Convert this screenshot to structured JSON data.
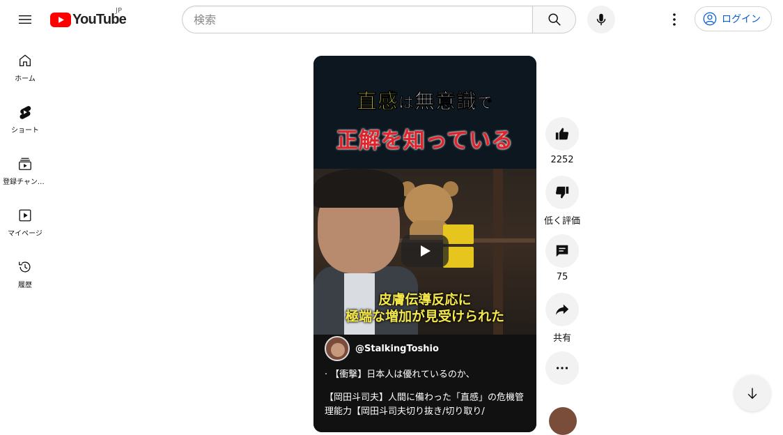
{
  "header": {
    "logo_text": "YouTube",
    "country_code": "JP",
    "search_placeholder": "検索",
    "login_label": "ログイン"
  },
  "sidebar": {
    "items": [
      {
        "label": "ホーム",
        "icon": "home-icon"
      },
      {
        "label": "ショート",
        "icon": "shorts-icon"
      },
      {
        "label": "登録チャンネル",
        "icon": "subscriptions-icon"
      },
      {
        "label": "マイページ",
        "icon": "my-page-icon"
      },
      {
        "label": "履歴",
        "icon": "history-icon"
      }
    ]
  },
  "short": {
    "caption_top_yellow1": "直感",
    "caption_top_white1": "は",
    "caption_top_yellow2": "無意識",
    "caption_top_white2": "で",
    "caption_red": "正解を知っている",
    "caption_bottom_line1": "皮膚伝導反応に",
    "caption_bottom_line2": "極端な増加が見受けられた",
    "channel_handle": "@StalkingToshio",
    "title_line1": "· 【衝撃】日本人は優れているのか、",
    "title_line2": "【岡田斗司夫】人間に備わった「直感」の危機管理能力【岡田斗司夫切り抜き/切り取り/"
  },
  "actions": {
    "like_count": "2252",
    "dislike_label": "低く評価",
    "comment_count": "75",
    "share_label": "共有"
  },
  "colors": {
    "brand_red": "#ff0000",
    "link_blue": "#065fd4",
    "button_gray": "#f2f2f2"
  }
}
